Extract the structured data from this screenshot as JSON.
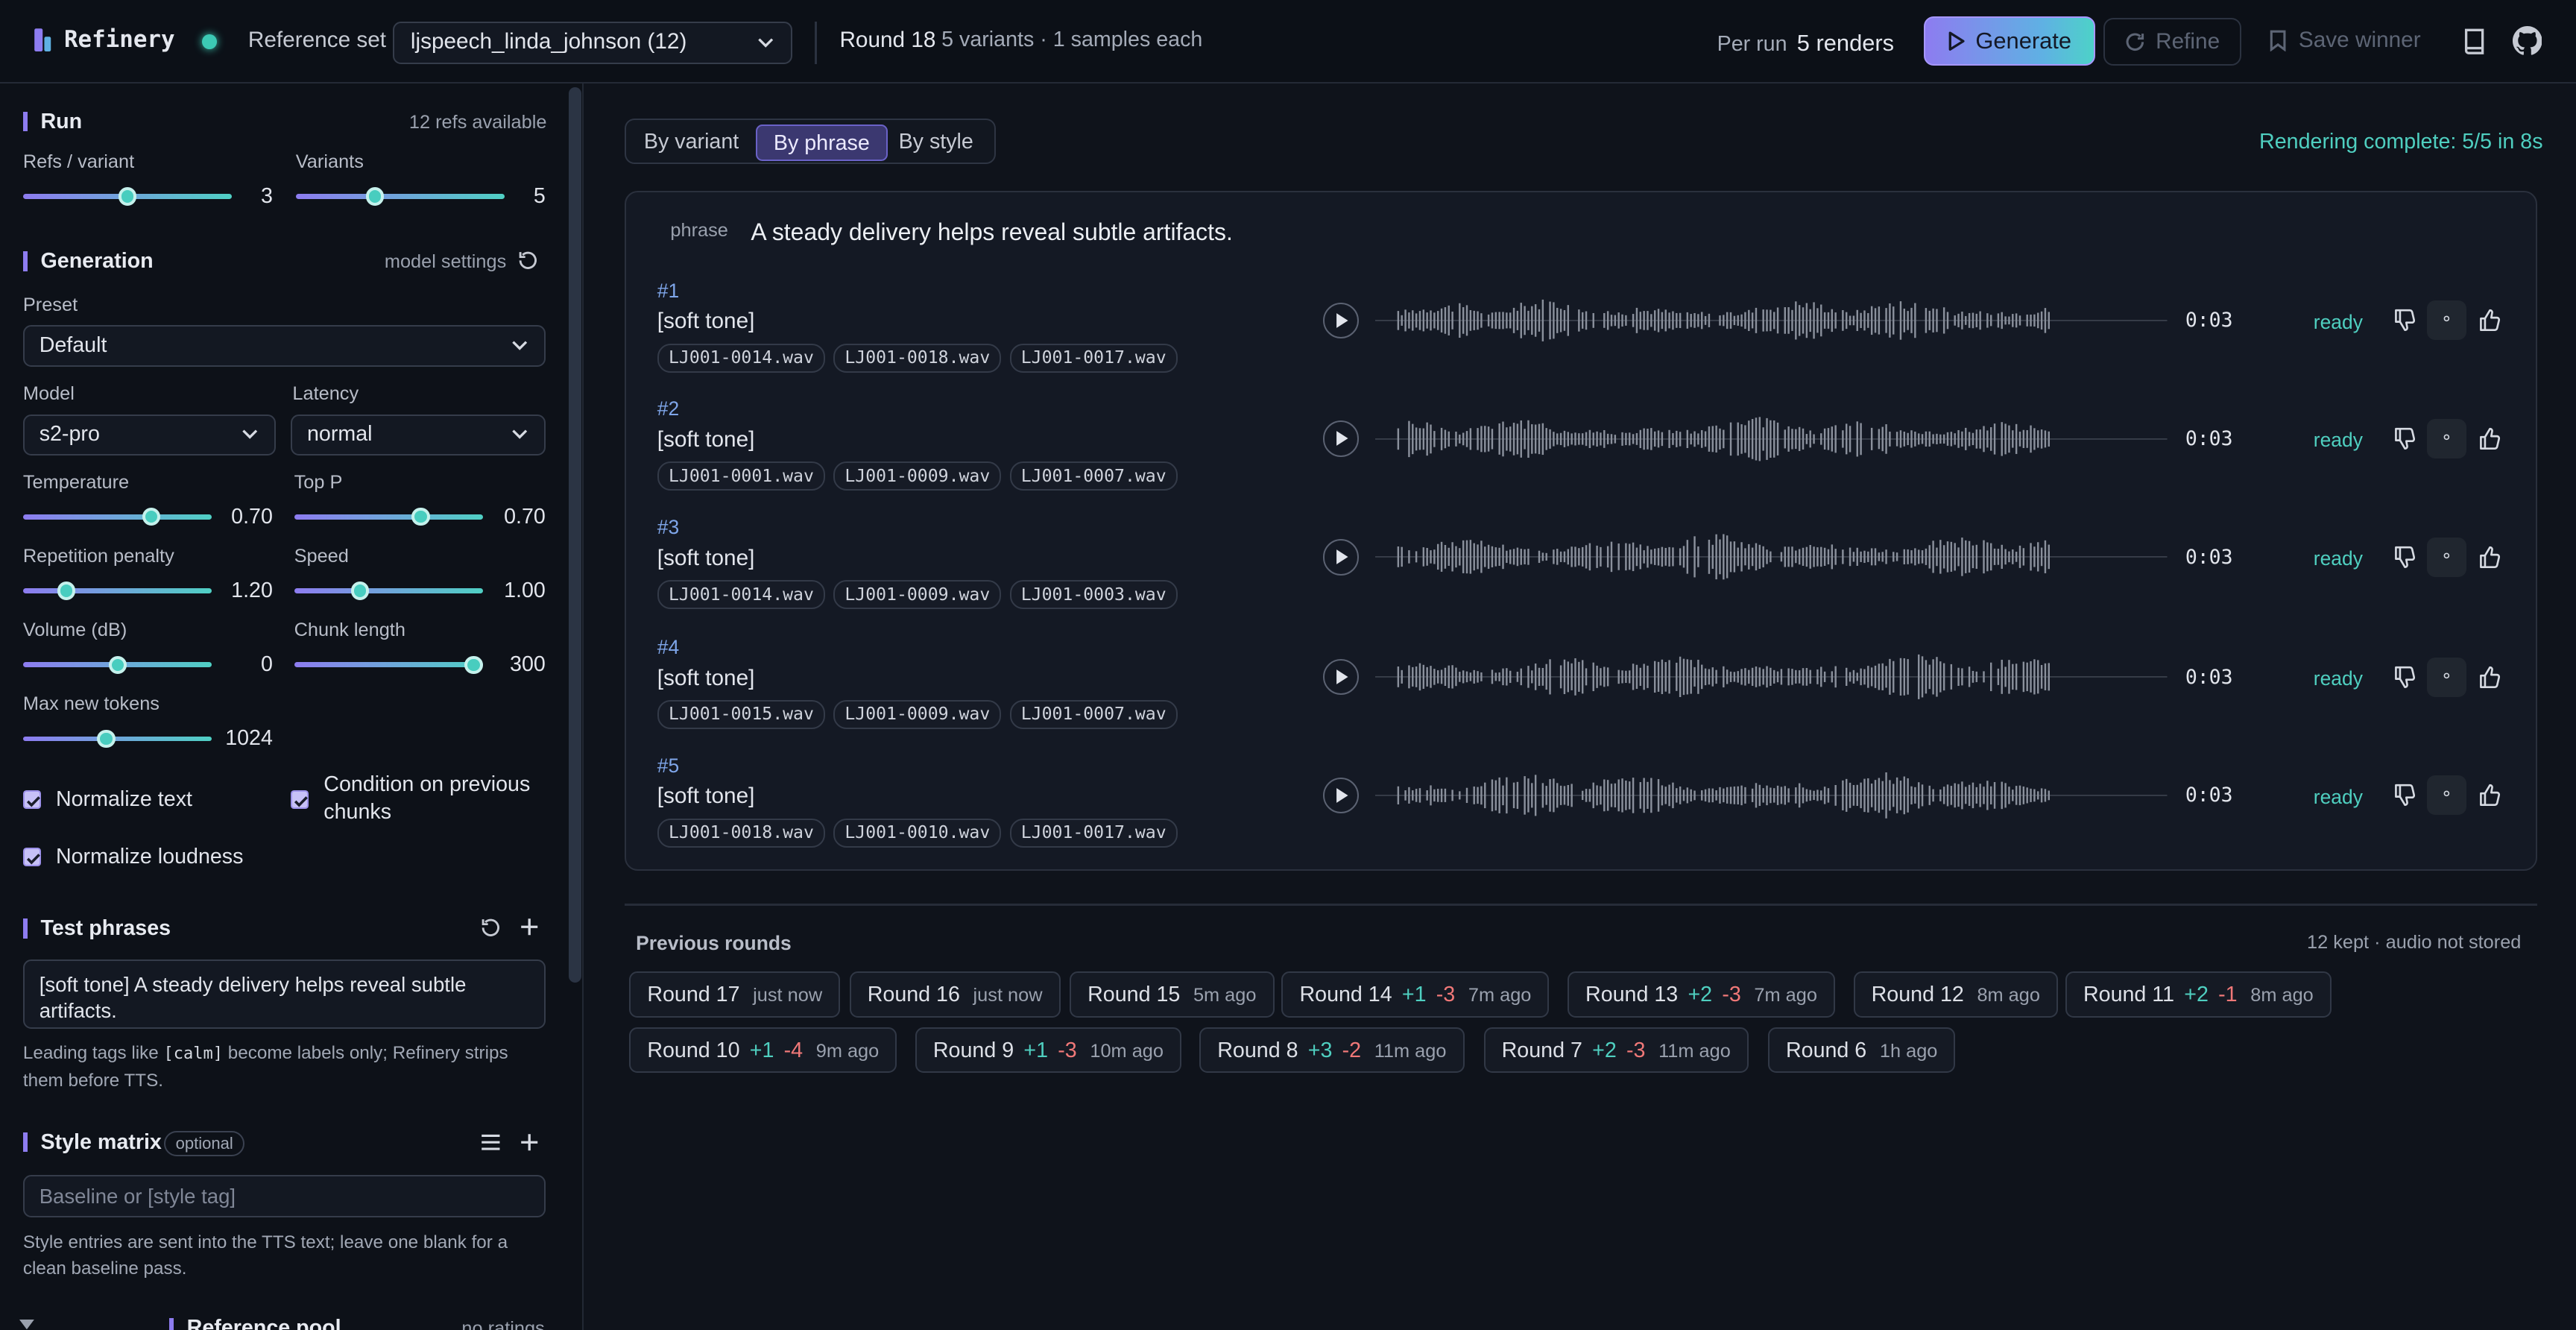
{
  "app": {
    "name": "Refinery",
    "status_color": "#3cc9b4",
    "accent": "#8d7cf0",
    "teal": "#4fcfc0"
  },
  "topbar": {
    "reference_label": "Reference set",
    "reference_value": "ljspeech_linda_johnson (12)",
    "round_title": "Round 18",
    "round_meta": "5 variants · 1 samples each",
    "per_run_label": "Per run",
    "per_run_value": "5 renders",
    "generate_label": "Generate",
    "refine_label": "Refine",
    "save_label": "Save winner"
  },
  "sidebar": {
    "run": {
      "title": "Run",
      "refs_available": "12 refs available",
      "refs_label": "Refs / variant",
      "refs_value": "3",
      "refs_fraction": 0.5,
      "variants_label": "Variants",
      "variants_value": "5",
      "variants_fraction": 0.38
    },
    "generation": {
      "title": "Generation",
      "model_settings": "model settings",
      "preset_label": "Preset",
      "preset_value": "Default",
      "model_label": "Model",
      "model_value": "s2-pro",
      "latency_label": "Latency",
      "latency_value": "normal",
      "temperature_label": "Temperature",
      "temperature_value": "0.70",
      "temperature_fraction": 0.68,
      "top_p_label": "Top P",
      "top_p_value": "0.70",
      "top_p_fraction": 0.67,
      "repetition_label": "Repetition penalty",
      "repetition_value": "1.20",
      "repetition_fraction": 0.23,
      "speed_label": "Speed",
      "speed_value": "1.00",
      "speed_fraction": 0.35,
      "volume_label": "Volume (dB)",
      "volume_value": "0",
      "volume_fraction": 0.5,
      "chunk_label": "Chunk length",
      "chunk_value": "300",
      "chunk_fraction": 0.95,
      "max_tokens_label": "Max new tokens",
      "max_tokens_value": "1024",
      "max_tokens_fraction": 0.44,
      "normalize_text": "Normalize text",
      "condition_prev": "Condition on previous chunks",
      "normalize_loudness": "Normalize loudness"
    },
    "test_phrases": {
      "title": "Test phrases",
      "value": "[soft tone] A steady delivery helps reveal subtle artifacts.",
      "hint_pre": "Leading tags like ",
      "hint_code": "[calm]",
      "hint_post": " become labels only; Refinery strips them before TTS."
    },
    "style_matrix": {
      "title": "Style matrix",
      "optional": "optional",
      "placeholder": "Baseline or [style tag]",
      "hint": "Style entries are sent into the TTS text; leave one blank for a clean baseline pass."
    },
    "reference_pool": {
      "title": "Reference pool",
      "meta": "no ratings"
    }
  },
  "main": {
    "tabs": [
      "By variant",
      "By phrase",
      "By style"
    ],
    "active_tab": "By phrase",
    "render_status": "Rendering complete: 5/5 in 8s",
    "phrase_tag": "phrase",
    "phrase_text": "A steady delivery helps reveal subtle artifacts.",
    "variants": [
      {
        "num": "#1",
        "name": "[soft tone]",
        "files": [
          "LJ001-0014.wav",
          "LJ001-0018.wav",
          "LJ001-0017.wav"
        ],
        "duration": "0:03",
        "status": "ready"
      },
      {
        "num": "#2",
        "name": "[soft tone]",
        "files": [
          "LJ001-0001.wav",
          "LJ001-0009.wav",
          "LJ001-0007.wav"
        ],
        "duration": "0:03",
        "status": "ready"
      },
      {
        "num": "#3",
        "name": "[soft tone]",
        "files": [
          "LJ001-0014.wav",
          "LJ001-0009.wav",
          "LJ001-0003.wav"
        ],
        "duration": "0:03",
        "status": "ready"
      },
      {
        "num": "#4",
        "name": "[soft tone]",
        "files": [
          "LJ001-0015.wav",
          "LJ001-0009.wav",
          "LJ001-0007.wav"
        ],
        "duration": "0:03",
        "status": "ready"
      },
      {
        "num": "#5",
        "name": "[soft tone]",
        "files": [
          "LJ001-0018.wav",
          "LJ001-0010.wav",
          "LJ001-0017.wav"
        ],
        "duration": "0:03",
        "status": "ready"
      }
    ],
    "neutral_glyph": "∘",
    "previous": {
      "title": "Previous rounds",
      "meta": "12 kept · audio not stored",
      "rounds": [
        {
          "label": "Round 17",
          "plus": "",
          "minus": "",
          "ago": "just now"
        },
        {
          "label": "Round 16",
          "plus": "",
          "minus": "",
          "ago": "just now"
        },
        {
          "label": "Round 15",
          "plus": "",
          "minus": "",
          "ago": "5m ago"
        },
        {
          "label": "Round 14",
          "plus": "+1",
          "minus": "-3",
          "ago": "7m ago"
        },
        {
          "label": "Round 13",
          "plus": "+2",
          "minus": "-3",
          "ago": "7m ago"
        },
        {
          "label": "Round 12",
          "plus": "",
          "minus": "",
          "ago": "8m ago"
        },
        {
          "label": "Round 11",
          "plus": "+2",
          "minus": "-1",
          "ago": "8m ago"
        },
        {
          "label": "Round 10",
          "plus": "+1",
          "minus": "-4",
          "ago": "9m ago"
        },
        {
          "label": "Round 9",
          "plus": "+1",
          "minus": "-3",
          "ago": "10m ago"
        },
        {
          "label": "Round 8",
          "plus": "+3",
          "minus": "-2",
          "ago": "11m ago"
        },
        {
          "label": "Round 7",
          "plus": "+2",
          "minus": "-3",
          "ago": "11m ago"
        },
        {
          "label": "Round 6",
          "plus": "",
          "minus": "",
          "ago": "1h ago"
        }
      ]
    }
  }
}
